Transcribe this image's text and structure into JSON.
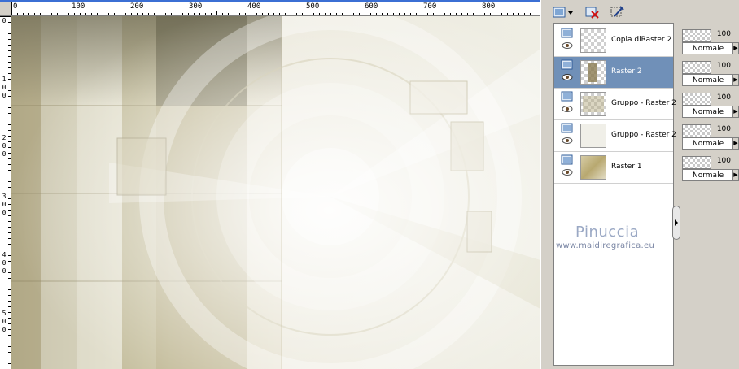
{
  "ruler": {
    "h_labels": [
      "0",
      "100",
      "200",
      "300",
      "400",
      "500",
      "600",
      "700",
      "800"
    ],
    "v_labels": [
      [
        "0"
      ],
      [
        "1",
        "0",
        "0"
      ],
      [
        "2",
        "0",
        "0"
      ],
      [
        "3",
        "0",
        "0"
      ],
      [
        "4",
        "0",
        "0"
      ],
      [
        "5",
        "0",
        "0"
      ]
    ]
  },
  "layers": [
    {
      "name": "Copia diRaster 2",
      "selected": false,
      "opacity": "100",
      "blend": "Normale"
    },
    {
      "name": "Raster 2",
      "selected": true,
      "opacity": "100",
      "blend": "Normale"
    },
    {
      "name": "Gruppo - Raster 2",
      "selected": false,
      "opacity": "100",
      "blend": "Normale"
    },
    {
      "name": "Gruppo - Raster 2",
      "selected": false,
      "opacity": "100",
      "blend": "Normale"
    },
    {
      "name": "Raster 1",
      "selected": false,
      "opacity": "100",
      "blend": "Normale"
    }
  ],
  "credit": {
    "name": "Pinuccia",
    "url": "www.maidiregrafica.eu"
  },
  "toolbar": {
    "icons": [
      "new-layer-icon",
      "delete-layer-icon",
      "layer-properties-icon"
    ]
  },
  "colors": {
    "selected_row": "#7090b8",
    "credit_text": "#9aa8c4",
    "ruler_accent": "#3b6fd4"
  }
}
